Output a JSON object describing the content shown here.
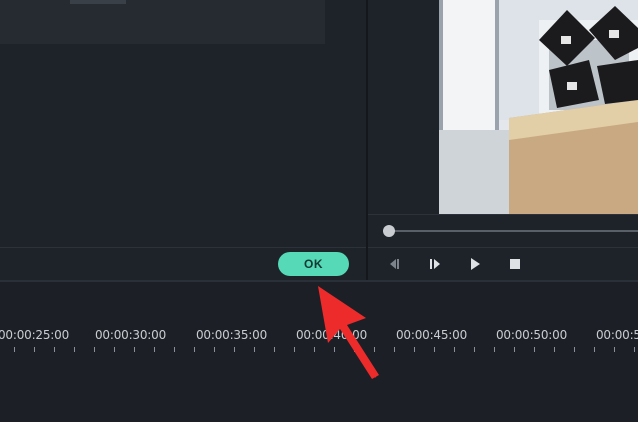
{
  "dialog": {
    "ok_label": "OK"
  },
  "preview": {
    "controls": [
      "step-back-icon",
      "step-forward-icon",
      "play-icon",
      "stop-icon"
    ],
    "playback_progress": 0.0
  },
  "timeline": {
    "labels": [
      "00:00:25:00",
      "00:00:30:00",
      "00:00:35:00",
      "00:00:40:00",
      "00:00:45:00",
      "00:00:50:00",
      "00:00:5"
    ]
  },
  "colors": {
    "accent": "#55d9b7",
    "arrow": "#ee2b2b",
    "panel_bg": "#1e2329"
  }
}
